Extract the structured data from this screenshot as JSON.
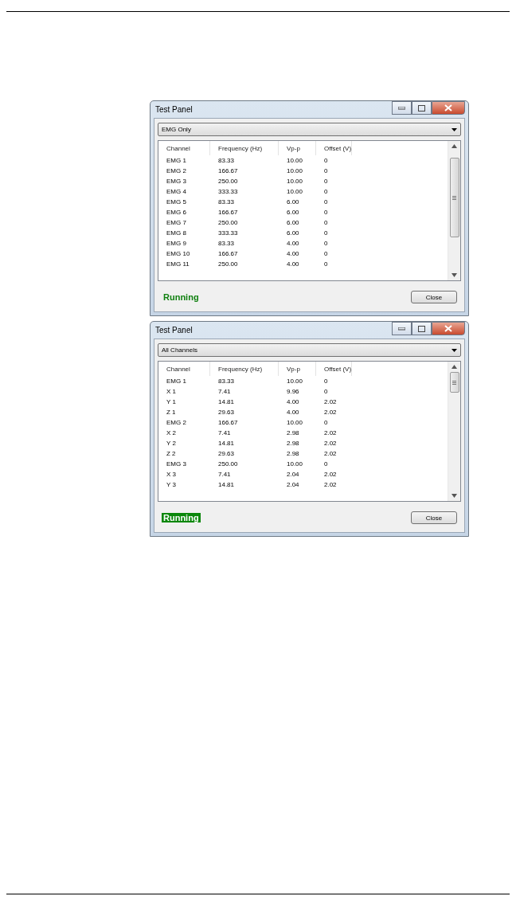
{
  "windows": [
    {
      "title": "Test Panel",
      "dropdown": "EMG Only",
      "columns": [
        "Channel",
        "Frequency (Hz)",
        "Vp-p",
        "Offset (V)"
      ],
      "rows": [
        [
          "EMG 1",
          "83.33",
          "10.00",
          "0"
        ],
        [
          "EMG 2",
          "166.67",
          "10.00",
          "0"
        ],
        [
          "EMG 3",
          "250.00",
          "10.00",
          "0"
        ],
        [
          "EMG 4",
          "333.33",
          "10.00",
          "0"
        ],
        [
          "EMG 5",
          "83.33",
          "6.00",
          "0"
        ],
        [
          "EMG 6",
          "166.67",
          "6.00",
          "0"
        ],
        [
          "EMG 7",
          "250.00",
          "6.00",
          "0"
        ],
        [
          "EMG 8",
          "333.33",
          "6.00",
          "0"
        ],
        [
          "EMG 9",
          "83.33",
          "4.00",
          "0"
        ],
        [
          "EMG 10",
          "166.67",
          "4.00",
          "0"
        ],
        [
          "EMG 11",
          "250.00",
          "4.00",
          "0"
        ]
      ],
      "status": {
        "text": "Running",
        "highlighted": false
      },
      "button": "Close"
    },
    {
      "title": "Test Panel",
      "dropdown": "All Channels",
      "columns": [
        "Channel",
        "Frequency (Hz)",
        "Vp-p",
        "Offset (V)"
      ],
      "rows": [
        [
          "EMG 1",
          "83.33",
          "10.00",
          "0"
        ],
        [
          "X 1",
          "7.41",
          "9.96",
          "0"
        ],
        [
          "Y 1",
          "14.81",
          "4.00",
          "2.02"
        ],
        [
          "Z 1",
          "29.63",
          "4.00",
          "2.02"
        ],
        [
          "EMG 2",
          "166.67",
          "10.00",
          "0"
        ],
        [
          "X 2",
          "7.41",
          "2.98",
          "2.02"
        ],
        [
          "Y 2",
          "14.81",
          "2.98",
          "2.02"
        ],
        [
          "Z 2",
          "29.63",
          "2.98",
          "2.02"
        ],
        [
          "EMG 3",
          "250.00",
          "10.00",
          "0"
        ],
        [
          "X 3",
          "7.41",
          "2.04",
          "2.02"
        ],
        [
          "Y 3",
          "14.81",
          "2.04",
          "2.02"
        ]
      ],
      "status": {
        "text": "Running",
        "highlighted": true
      },
      "button": "Close"
    }
  ]
}
